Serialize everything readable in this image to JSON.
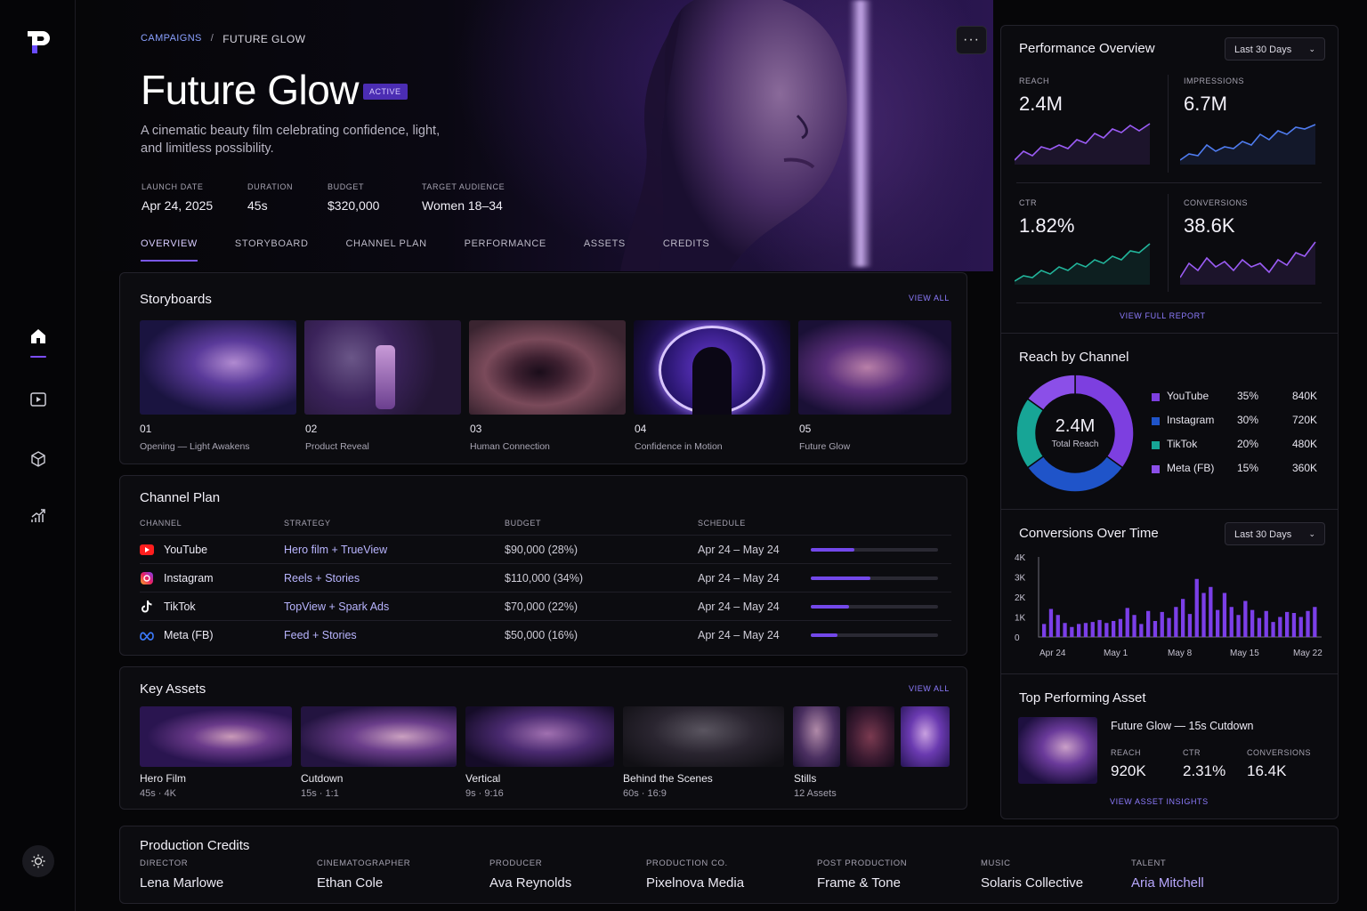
{
  "breadcrumb": {
    "parent": "CAMPAIGNS",
    "separator": "/",
    "current": "FUTURE GLOW"
  },
  "campaign": {
    "title": "Future Glow",
    "status": "ACTIVE",
    "description": "A cinematic beauty film celebrating confidence, light, and limitless possibility."
  },
  "meta": [
    {
      "label": "LAUNCH DATE",
      "value": "Apr 24, 2025"
    },
    {
      "label": "DURATION",
      "value": "45s"
    },
    {
      "label": "BUDGET",
      "value": "$320,000"
    },
    {
      "label": "TARGET AUDIENCE",
      "value": "Women 18–34"
    }
  ],
  "tabs": [
    "OVERVIEW",
    "STORYBOARD",
    "CHANNEL PLAN",
    "PERFORMANCE",
    "ASSETS",
    "CREDITS"
  ],
  "more_label": "···",
  "storyboards": {
    "title": "Storyboards",
    "view_all": "VIEW ALL",
    "items": [
      {
        "num": "01",
        "label": "Opening — Light Awakens"
      },
      {
        "num": "02",
        "label": "Product Reveal"
      },
      {
        "num": "03",
        "label": "Human Connection"
      },
      {
        "num": "04",
        "label": "Confidence in Motion"
      },
      {
        "num": "05",
        "label": "Future Glow"
      }
    ]
  },
  "channel_plan": {
    "title": "Channel Plan",
    "headers": [
      "CHANNEL",
      "STRATEGY",
      "BUDGET",
      "SCHEDULE"
    ],
    "rows": [
      {
        "channel": "YouTube",
        "strategy": "Hero film + TrueView",
        "budget": "$90,000 (28%)",
        "schedule": "Apr 24 – May 24",
        "progress": 0.34
      },
      {
        "channel": "Instagram",
        "strategy": "Reels + Stories",
        "budget": "$110,000 (34%)",
        "schedule": "Apr 24 – May 24",
        "progress": 0.47
      },
      {
        "channel": "TikTok",
        "strategy": "TopView + Spark Ads",
        "budget": "$70,000 (22%)",
        "schedule": "Apr 24 – May 24",
        "progress": 0.3
      },
      {
        "channel": "Meta (FB)",
        "strategy": "Feed + Stories",
        "budget": "$50,000 (16%)",
        "schedule": "Apr 24 – May 24",
        "progress": 0.21
      }
    ]
  },
  "key_assets": {
    "title": "Key Assets",
    "view_all": "VIEW ALL",
    "items": [
      {
        "name": "Hero Film",
        "sub": "45s · 4K"
      },
      {
        "name": "Cutdown",
        "sub": "15s · 1:1"
      },
      {
        "name": "Vertical",
        "sub": "9s · 9:16"
      },
      {
        "name": "Behind the Scenes",
        "sub": "60s · 16:9"
      },
      {
        "name": "Stills",
        "sub": "12 Assets"
      }
    ]
  },
  "credits": {
    "title": "Production Credits",
    "items": [
      {
        "role": "DIRECTOR",
        "name": "Lena Marlowe"
      },
      {
        "role": "CINEMATOGRAPHER",
        "name": "Ethan Cole"
      },
      {
        "role": "PRODUCER",
        "name": "Ava Reynolds"
      },
      {
        "role": "PRODUCTION CO.",
        "name": "Pixelnova Media"
      },
      {
        "role": "POST PRODUCTION",
        "name": "Frame & Tone"
      },
      {
        "role": "MUSIC",
        "name": "Solaris Collective"
      },
      {
        "role": "TALENT",
        "name": "Aria Mitchell"
      }
    ]
  },
  "performance": {
    "title": "Performance Overview",
    "range": "Last 30 Days",
    "view_report": "VIEW FULL REPORT",
    "kpis": [
      {
        "label": "REACH",
        "value": "2.4M",
        "color": "#9b5cf5"
      },
      {
        "label": "IMPRESSIONS",
        "value": "6.7M",
        "color": "#4f7cf0"
      },
      {
        "label": "CTR",
        "value": "1.82%",
        "color": "#22b59b"
      },
      {
        "label": "CONVERSIONS",
        "value": "38.6K",
        "color": "#9b5cf5"
      }
    ]
  },
  "reach_by_channel": {
    "title": "Reach by Channel",
    "center_value": "2.4M",
    "center_label": "Total Reach"
  },
  "conversions": {
    "title": "Conversions Over Time",
    "range": "Last 30 Days"
  },
  "top_asset": {
    "title": "Top Performing Asset",
    "name": "Future Glow — 15s Cutdown",
    "stats": [
      {
        "label": "REACH",
        "value": "920K"
      },
      {
        "label": "CTR",
        "value": "2.31%"
      },
      {
        "label": "CONVERSIONS",
        "value": "16.4K"
      }
    ],
    "link": "VIEW ASSET INSIGHTS"
  },
  "chart_data": [
    {
      "type": "pie",
      "title": "Reach by Channel",
      "categories": [
        "YouTube",
        "Instagram",
        "TikTok",
        "Meta (FB)"
      ],
      "values": [
        35,
        30,
        20,
        15
      ],
      "value_labels": [
        "35%",
        "30%",
        "20%",
        "15%"
      ],
      "counts": [
        "840K",
        "720K",
        "480K",
        "360K"
      ],
      "colors": [
        "#7d3fe0",
        "#1f54c9",
        "#17a596",
        "#8b4fe8"
      ]
    },
    {
      "type": "bar",
      "title": "Conversions Over Time",
      "xlabel": "",
      "ylabel": "",
      "ylim": [
        0,
        4000
      ],
      "yticks": [
        "4K",
        "3K",
        "2K",
        "1K",
        "0"
      ],
      "xticks": [
        "Apr 24",
        "May 1",
        "May 8",
        "May 15",
        "May 22"
      ],
      "values": [
        650,
        1400,
        1100,
        700,
        500,
        650,
        700,
        750,
        850,
        700,
        800,
        900,
        1450,
        1100,
        650,
        1300,
        800,
        1250,
        950,
        1500,
        1900,
        1150,
        2900,
        2200,
        2500,
        1350,
        2200,
        1500,
        1100,
        1800,
        1350,
        950,
        1300,
        750,
        1000,
        1250,
        1200,
        1000,
        1300,
        1500
      ]
    }
  ]
}
